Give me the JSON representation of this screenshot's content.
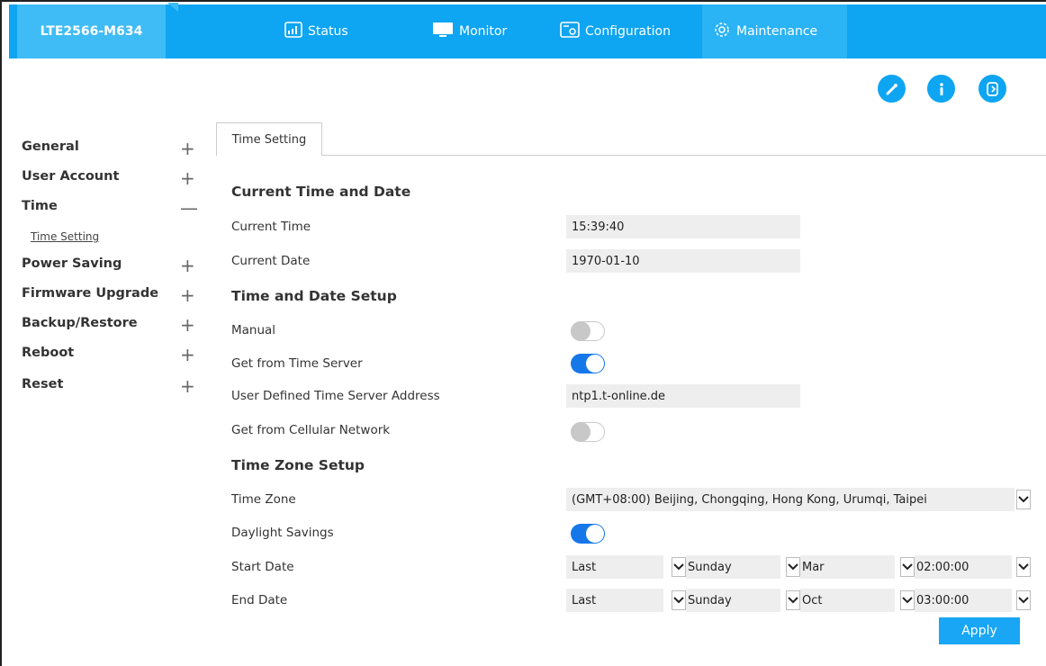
{
  "header": {
    "brand": "LTE2566-M634",
    "tabs": [
      {
        "label": "Status",
        "icon": "status-chart-icon"
      },
      {
        "label": "Monitor",
        "icon": "monitor-icon"
      },
      {
        "label": "Configuration",
        "icon": "configuration-icon"
      },
      {
        "label": "Maintenance",
        "icon": "gear-icon"
      }
    ],
    "active_tab": "Maintenance"
  },
  "toolbar": {
    "icons": [
      "wizard-icon",
      "info-icon",
      "logout-icon"
    ]
  },
  "sidebar": {
    "items": [
      {
        "label": "General",
        "expander": "+"
      },
      {
        "label": "User Account",
        "expander": "+"
      },
      {
        "label": "Time",
        "expander": "—"
      },
      {
        "label": "Power Saving",
        "expander": "+"
      },
      {
        "label": "Firmware Upgrade",
        "expander": "+"
      },
      {
        "label": "Backup/Restore",
        "expander": "+"
      },
      {
        "label": "Reboot",
        "expander": "+"
      },
      {
        "label": "Reset",
        "expander": "+"
      }
    ],
    "sub_item": "Time Setting"
  },
  "main": {
    "tab_label": "Time Setting",
    "sections": {
      "current": "Current Time and Date",
      "setup": "Time and Date Setup",
      "zone": "Time Zone Setup"
    },
    "fields": {
      "current_time": {
        "label": "Current Time",
        "value": "15:39:40"
      },
      "current_date": {
        "label": "Current Date",
        "value": "1970-01-10"
      },
      "manual": {
        "label": "Manual",
        "state": "off"
      },
      "time_server": {
        "label": "Get from Time Server",
        "state": "on"
      },
      "server_address": {
        "label": "User Defined Time Server Address",
        "value": "ntp1.t-online.de"
      },
      "cellular": {
        "label": "Get from Cellular Network",
        "state": "off"
      },
      "time_zone": {
        "label": "Time Zone",
        "value": "(GMT+08:00) Beijing, Chongqing, Hong Kong, Urumqi, Taipei"
      },
      "daylight": {
        "label": "Daylight Savings",
        "state": "on"
      },
      "start_date": {
        "label": "Start Date",
        "week": "Last",
        "day": "Sunday",
        "month": "Mar",
        "time": "02:00:00"
      },
      "end_date": {
        "label": "End Date",
        "week": "Last",
        "day": "Sunday",
        "month": "Oct",
        "time": "03:00:00"
      }
    },
    "apply_label": "Apply"
  },
  "colors": {
    "header_bg": "#0ea5f2",
    "brand_bg": "#3fbcf5",
    "toggle_on": "#1677e8",
    "field_bg": "#eeeeee"
  }
}
